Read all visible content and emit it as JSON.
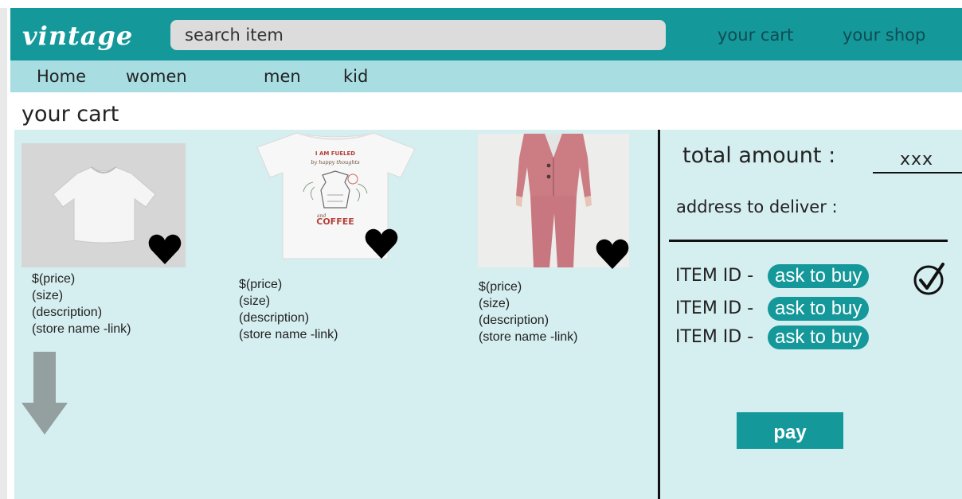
{
  "header": {
    "logo": "vintage",
    "search_placeholder": "search item",
    "cart_link": "your cart",
    "shop_link": "your shop"
  },
  "nav": {
    "items": [
      "Home",
      "women",
      "men",
      "kid"
    ]
  },
  "page": {
    "title": "your cart"
  },
  "products": [
    {
      "price": "$(price)",
      "size": "(size)",
      "description": "(description)",
      "store": "(store name -link)",
      "image": "white-tshirt",
      "shirt_text_1": "I AM FUELED",
      "shirt_text_2": "by happy thoughts",
      "shirt_text_3": "and",
      "shirt_text_4": "COFFEE"
    },
    {
      "price": "$(price)",
      "size": "(size)",
      "description": "(description)",
      "store": "(store name -link)",
      "image": "coffee-print-tshirt"
    },
    {
      "price": "$(price)",
      "size": "(size)",
      "description": "(description)",
      "store": "(store name -link)",
      "image": "pink-suit"
    }
  ],
  "summary": {
    "total_label": "total amount :",
    "total_value": "xxx",
    "address_label": "address to deliver :",
    "items": [
      {
        "label": "ITEM ID -",
        "button": "ask to buy",
        "checked": true
      },
      {
        "label": "ITEM ID -",
        "button": "ask to buy",
        "checked": false
      },
      {
        "label": "ITEM ID -",
        "button": "ask to buy",
        "checked": false
      }
    ],
    "pay_label": "pay"
  },
  "colors": {
    "brand": "#15989a",
    "nav_bg": "#a8dde2",
    "content_bg": "#d5eef0",
    "search_bg": "#dcdcdc"
  },
  "icons": [
    "heart-icon",
    "down-arrow-icon",
    "checkmark-icon"
  ]
}
